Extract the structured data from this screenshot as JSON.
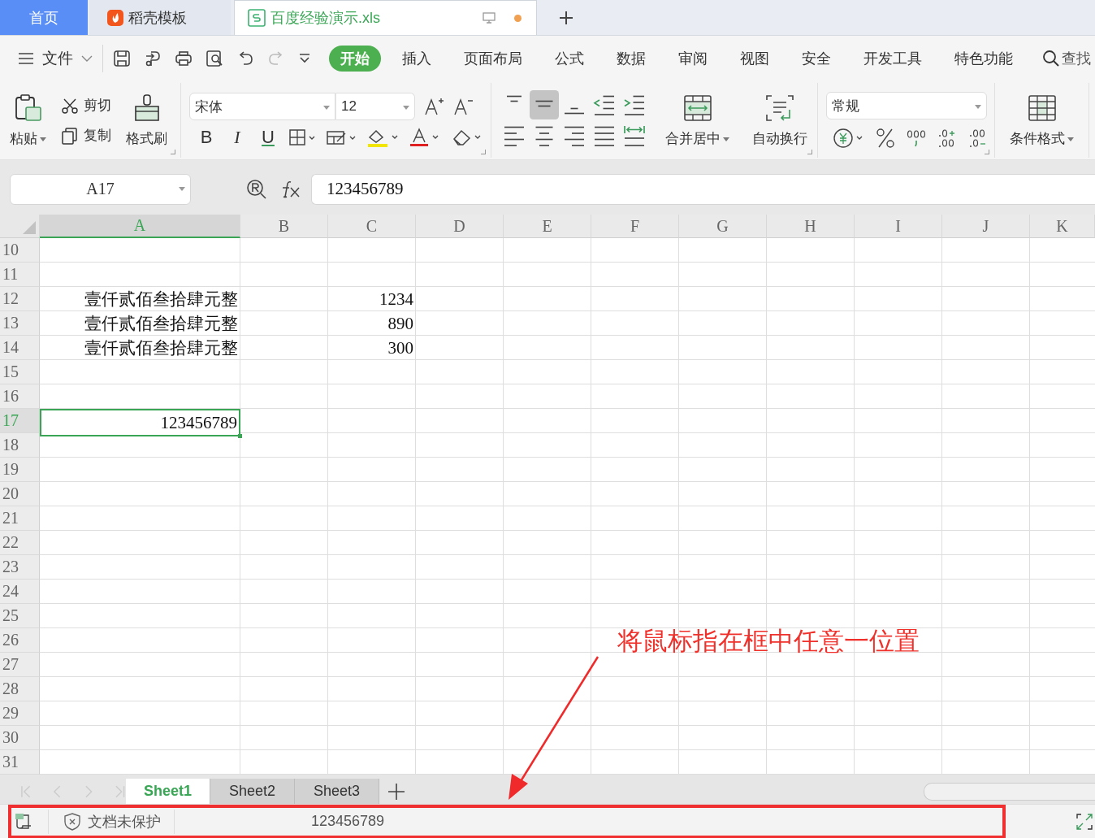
{
  "title_tabs": [
    {
      "label": "首页",
      "kind": "home",
      "selected": false
    },
    {
      "label": "稻壳模板",
      "kind": "template",
      "selected": false
    },
    {
      "label": "百度经验演示.xls",
      "kind": "file",
      "selected": true,
      "unsaved": true
    }
  ],
  "menu": {
    "file_label": "文件",
    "tabs": [
      {
        "label": "开始",
        "selected": true
      },
      {
        "label": "插入",
        "selected": false
      },
      {
        "label": "页面布局",
        "selected": false
      },
      {
        "label": "公式",
        "selected": false
      },
      {
        "label": "数据",
        "selected": false
      },
      {
        "label": "审阅",
        "selected": false
      },
      {
        "label": "视图",
        "selected": false
      },
      {
        "label": "安全",
        "selected": false
      },
      {
        "label": "开发工具",
        "selected": false
      },
      {
        "label": "特色功能",
        "selected": false
      }
    ],
    "search_label": "查找"
  },
  "ribbon": {
    "paste": "粘贴",
    "cut": "剪切",
    "copy": "复制",
    "format_painter": "格式刷",
    "font_name": "宋体",
    "font_size": "12",
    "style_buttons": [
      "B",
      "I",
      "U"
    ],
    "align_buttons": [
      {
        "kind": "top",
        "selected": false
      },
      {
        "kind": "middle",
        "selected": true
      },
      {
        "kind": "bottom",
        "selected": false
      },
      {
        "kind": "indent-decrease",
        "selected": false
      },
      {
        "kind": "indent-increase",
        "selected": false
      },
      {
        "kind": "left",
        "selected": false
      },
      {
        "kind": "center",
        "selected": false
      },
      {
        "kind": "right",
        "selected": false
      },
      {
        "kind": "justify",
        "selected": false
      },
      {
        "kind": "distributed",
        "selected": false
      }
    ],
    "merge": "合并居中",
    "wrap": "自动换行",
    "number_format": "常规",
    "conditional_format": "条件格式"
  },
  "formula_bar": {
    "name_box": "A17",
    "formula": "123456789"
  },
  "columns": [
    {
      "label": "A",
      "selected": true
    },
    {
      "label": "B",
      "selected": false
    },
    {
      "label": "C",
      "selected": false
    },
    {
      "label": "D",
      "selected": false
    },
    {
      "label": "E",
      "selected": false
    },
    {
      "label": "F",
      "selected": false
    },
    {
      "label": "G",
      "selected": false
    },
    {
      "label": "H",
      "selected": false
    },
    {
      "label": "I",
      "selected": false
    },
    {
      "label": "J",
      "selected": false
    },
    {
      "label": "K",
      "selected": false
    }
  ],
  "rows": [
    {
      "number": "10",
      "selected": false
    },
    {
      "number": "11",
      "selected": false
    },
    {
      "number": "12",
      "selected": false,
      "column_a": "壹仟贰佰叁拾肆元整",
      "column_c": "1234"
    },
    {
      "number": "13",
      "selected": false,
      "column_a": "壹仟贰佰叁拾肆元整",
      "column_c": "890"
    },
    {
      "number": "14",
      "selected": false,
      "column_a": "壹仟贰佰叁拾肆元整",
      "column_c": "300"
    },
    {
      "number": "15",
      "selected": false
    },
    {
      "number": "16",
      "selected": false
    },
    {
      "number": "17",
      "selected": true,
      "column_a": "123456789"
    },
    {
      "number": "18",
      "selected": false
    },
    {
      "number": "19",
      "selected": false
    },
    {
      "number": "20",
      "selected": false
    },
    {
      "number": "21",
      "selected": false
    },
    {
      "number": "22",
      "selected": false
    },
    {
      "number": "23",
      "selected": false
    },
    {
      "number": "24",
      "selected": false
    },
    {
      "number": "25",
      "selected": false
    },
    {
      "number": "26",
      "selected": false
    },
    {
      "number": "27",
      "selected": false
    },
    {
      "number": "28",
      "selected": false
    },
    {
      "number": "29",
      "selected": false
    },
    {
      "number": "30",
      "selected": false
    },
    {
      "number": "31",
      "selected": false
    }
  ],
  "sheet_tabs": [
    {
      "label": "Sheet1",
      "selected": true
    },
    {
      "label": "Sheet2",
      "selected": false
    },
    {
      "label": "Sheet3",
      "selected": false
    }
  ],
  "status_bar": {
    "protection": "文档未保护",
    "value": "123456789"
  },
  "annotation": {
    "text": "将鼠标指在框中任意一位置"
  }
}
